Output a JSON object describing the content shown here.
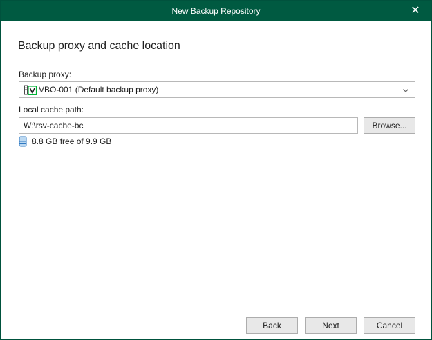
{
  "window": {
    "title": "New Backup Repository",
    "close_glyph": "✕"
  },
  "page": {
    "heading": "Backup proxy and cache location"
  },
  "backup_proxy": {
    "label": "Backup proxy:",
    "selected_value": "VBO-001 (Default backup proxy)",
    "icon": "veeam-proxy-icon"
  },
  "local_cache": {
    "label": "Local cache path:",
    "value": "W:\\rsv-cache-bc",
    "browse_label": "Browse..."
  },
  "storage_info": {
    "icon": "database-icon",
    "text": "8.8 GB free of 9.9 GB"
  },
  "footer": {
    "back_label": "Back",
    "next_label": "Next",
    "cancel_label": "Cancel"
  },
  "colors": {
    "titlebar": "#005a41",
    "accent": "#00b336"
  }
}
